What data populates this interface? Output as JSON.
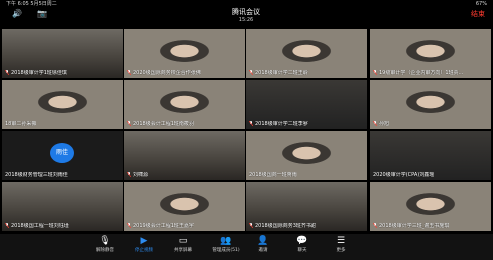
{
  "status": {
    "left": "下午 6:05  5月5日周二",
    "right": "67%"
  },
  "header": {
    "title": "腾讯会议",
    "time": "15:26",
    "end_label": "结束"
  },
  "tiles": [
    {
      "label": "2018级审计学1班徐佳琪",
      "mic": "muted",
      "scene": "room"
    },
    {
      "label": "2020级国际商务校企合作张佛",
      "mic": "muted",
      "scene": "person"
    },
    {
      "label": "2018级审计学二班王聆",
      "mic": "muted",
      "scene": "person"
    },
    {
      "label": "19级审计学（企业内审方向）1班贾...",
      "mic": "muted",
      "scene": "person",
      "active": true
    },
    {
      "label": "18审二孙采薇",
      "mic": "none",
      "scene": "person"
    },
    {
      "label": "2018级会计工程1班南筱羽",
      "mic": "muted",
      "scene": "person"
    },
    {
      "label": "2018级审计学二班李寥",
      "mic": "muted",
      "scene": "dark"
    },
    {
      "label": "孙旭",
      "mic": "muted",
      "scene": "person"
    },
    {
      "label": "2018级财务管理三班刘雨佳",
      "mic": "none",
      "scene": "avatar",
      "avatar_text": "雨佳"
    },
    {
      "label": "刘啸源",
      "mic": "muted",
      "scene": "room"
    },
    {
      "label": "2018级国商一班蒋雨",
      "mic": "none",
      "scene": "person"
    },
    {
      "label": "2020级审计学(CPA)刘鑫瑶",
      "mic": "none",
      "scene": "dark"
    },
    {
      "label": "2018级国工程一班刘钰瑾",
      "mic": "muted",
      "scene": "room"
    },
    {
      "label": "2019级会计工程1班王嘉宇",
      "mic": "muted",
      "scene": "person"
    },
    {
      "label": "2018级国际商务3班齐书甜",
      "mic": "muted",
      "scene": "room"
    },
    {
      "label": "2018级审计学三班_谢玉书施琪",
      "mic": "muted",
      "scene": "person"
    }
  ],
  "toolbar": [
    {
      "label": "解除静音",
      "icon": "mic-muted-icon",
      "glyph": "🎙"
    },
    {
      "label": "停止视频",
      "icon": "video-icon",
      "glyph": "▶",
      "on": true
    },
    {
      "label": "共享屏幕",
      "icon": "share-screen-icon",
      "glyph": "▭"
    },
    {
      "label": "管理成员(51)",
      "icon": "members-icon",
      "glyph": "👥"
    },
    {
      "label": "邀请",
      "icon": "invite-icon",
      "glyph": "👤"
    },
    {
      "label": "聊天",
      "icon": "chat-icon",
      "glyph": "💬"
    },
    {
      "label": "更多",
      "icon": "more-icon",
      "glyph": "☰"
    }
  ]
}
